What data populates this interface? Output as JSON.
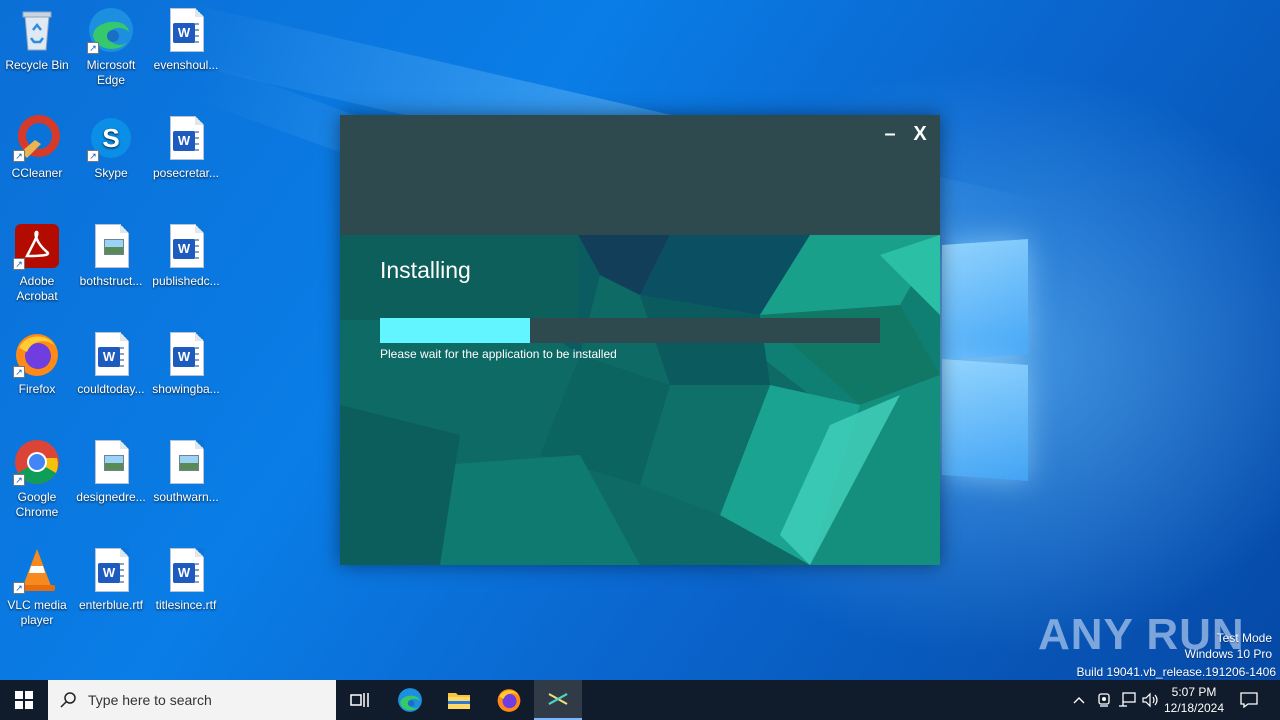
{
  "desktop": {
    "icons": [
      {
        "label": "Recycle Bin"
      },
      {
        "label": "Microsoft Edge"
      },
      {
        "label": "evenshoul..."
      },
      {
        "label": "CCleaner"
      },
      {
        "label": "Skype"
      },
      {
        "label": "posecretar..."
      },
      {
        "label": "Adobe Acrobat"
      },
      {
        "label": "bothstruct..."
      },
      {
        "label": "publishedc..."
      },
      {
        "label": "Firefox"
      },
      {
        "label": "couldtoday..."
      },
      {
        "label": "showingba..."
      },
      {
        "label": "Google Chrome"
      },
      {
        "label": "designedre..."
      },
      {
        "label": "southwarn..."
      },
      {
        "label": "VLC media player"
      },
      {
        "label": "enterblue.rtf"
      },
      {
        "label": "titlesince.rtf"
      }
    ]
  },
  "installer": {
    "minimize_label": "–",
    "close_label": "X",
    "title": "Installing",
    "status": "Please wait for the application to be installed",
    "progress": 0.3,
    "accent_color": "#63f5ff"
  },
  "watermark": {
    "brand": "ANY RUN",
    "line1": "Test Mode",
    "line2": "Windows 10 Pro",
    "line3": "Build 19041.vb_release.191206-1406"
  },
  "taskbar": {
    "search_placeholder": "Type here to search",
    "time": "5:07 PM",
    "date": "12/18/2024",
    "apps": [
      "task-view",
      "edge",
      "file-explorer",
      "firefox",
      "installer"
    ]
  }
}
